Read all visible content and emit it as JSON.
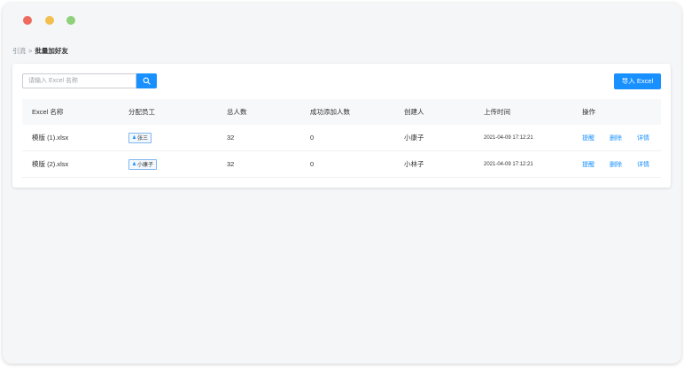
{
  "window": {
    "controls": [
      "close",
      "minimize",
      "maximize"
    ]
  },
  "breadcrumb": {
    "parent": "引流",
    "separator": ">",
    "current": "批量加好友"
  },
  "search": {
    "placeholder": "请输入 Excel 名称",
    "value": "",
    "icon": "search-icon"
  },
  "toolbar": {
    "import_label": "导入 Excel"
  },
  "table": {
    "headers": [
      "Excel 名称",
      "分配员工",
      "总人数",
      "成功添加人数",
      "创建人",
      "上传时间",
      "操作"
    ],
    "rows": [
      {
        "name": "模版 (1).xlsx",
        "staff": "张三",
        "total": "32",
        "success": "0",
        "creator": "小康子",
        "upload_time": "2021-04-09 17:12:21",
        "actions": [
          "提醒",
          "删除",
          "详情"
        ]
      },
      {
        "name": "模版 (2).xlsx",
        "staff": "小康子",
        "total": "32",
        "success": "0",
        "creator": "小林子",
        "upload_time": "2021-04-09 17:12:21",
        "actions": [
          "提醒",
          "删除",
          "详情"
        ]
      }
    ]
  },
  "colors": {
    "accent": "#1890ff",
    "background": "#f5f6f8",
    "close": "#ee6a5e",
    "minimize": "#f2bf4f",
    "maximize": "#8fd07a"
  }
}
